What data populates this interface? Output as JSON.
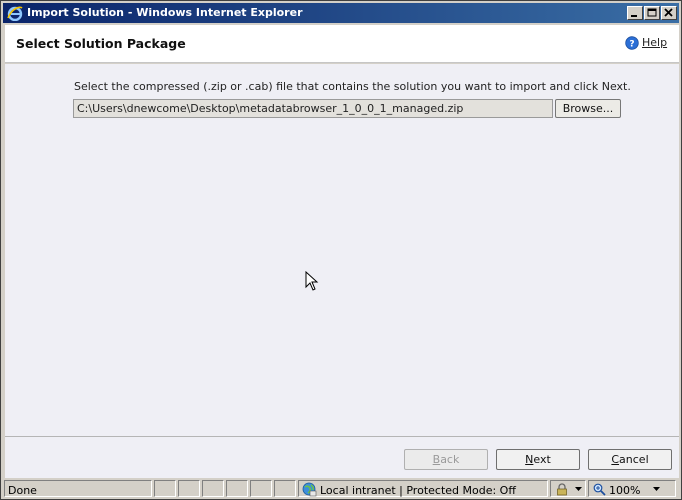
{
  "window": {
    "title": "Import Solution - Windows Internet Explorer"
  },
  "header": {
    "heading": "Select Solution Package",
    "help_label": "Help"
  },
  "content": {
    "instruction": "Select the compressed (.zip or .cab) file that contains the solution you want to import and click Next.",
    "file_path": "C:\\Users\\dnewcome\\Desktop\\metadatabrowser_1_0_0_1_managed.zip",
    "browse_label": "Browse..."
  },
  "footer": {
    "back": {
      "key": "B",
      "rest": "ack",
      "enabled": false
    },
    "next": {
      "key": "N",
      "rest": "ext",
      "enabled": true
    },
    "cancel": {
      "key": "C",
      "rest": "ancel",
      "enabled": true
    }
  },
  "statusbar": {
    "status": "Done",
    "zone": "Local intranet | Protected Mode: Off",
    "zoom": "100%"
  },
  "colors": {
    "title_start": "#0a246a",
    "title_end": "#3a6ea5",
    "content_bg": "#efeff5",
    "chrome": "#d4d0c8"
  },
  "icons": [
    "ie-icon",
    "minimize-icon",
    "maximize-icon",
    "close-icon",
    "help-icon",
    "mouse-cursor-icon",
    "globe-icon",
    "lock-icon",
    "zoom-icon",
    "chevron-down-icon"
  ]
}
